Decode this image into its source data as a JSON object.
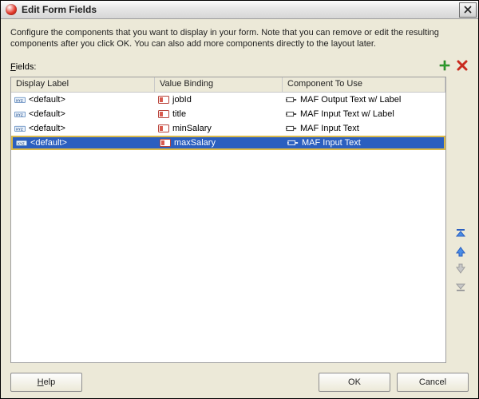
{
  "window": {
    "title": "Edit Form Fields"
  },
  "instructions": "Configure the components that you want to display in your form.  Note that you can remove or edit the resulting components after you click OK.  You can also add more components directly to the layout later.",
  "fields_label_prefix": "F",
  "fields_label_rest": "ields:",
  "columns": {
    "display_label": "Display Label",
    "value_binding": "Value Binding",
    "component": "Component To Use"
  },
  "rows": [
    {
      "display": "<default>",
      "binding": "jobId",
      "component": "MAF Output Text w/ Label",
      "selected": false
    },
    {
      "display": "<default>",
      "binding": "title",
      "component": "MAF Input Text w/ Label",
      "selected": false
    },
    {
      "display": "<default>",
      "binding": "minSalary",
      "component": "MAF Input Text",
      "selected": false
    },
    {
      "display": "<default>",
      "binding": "maxSalary",
      "component": "MAF Input Text",
      "selected": true
    }
  ],
  "buttons": {
    "help": "elp",
    "help_prefix": "H",
    "ok": "OK",
    "cancel": "Cancel"
  }
}
